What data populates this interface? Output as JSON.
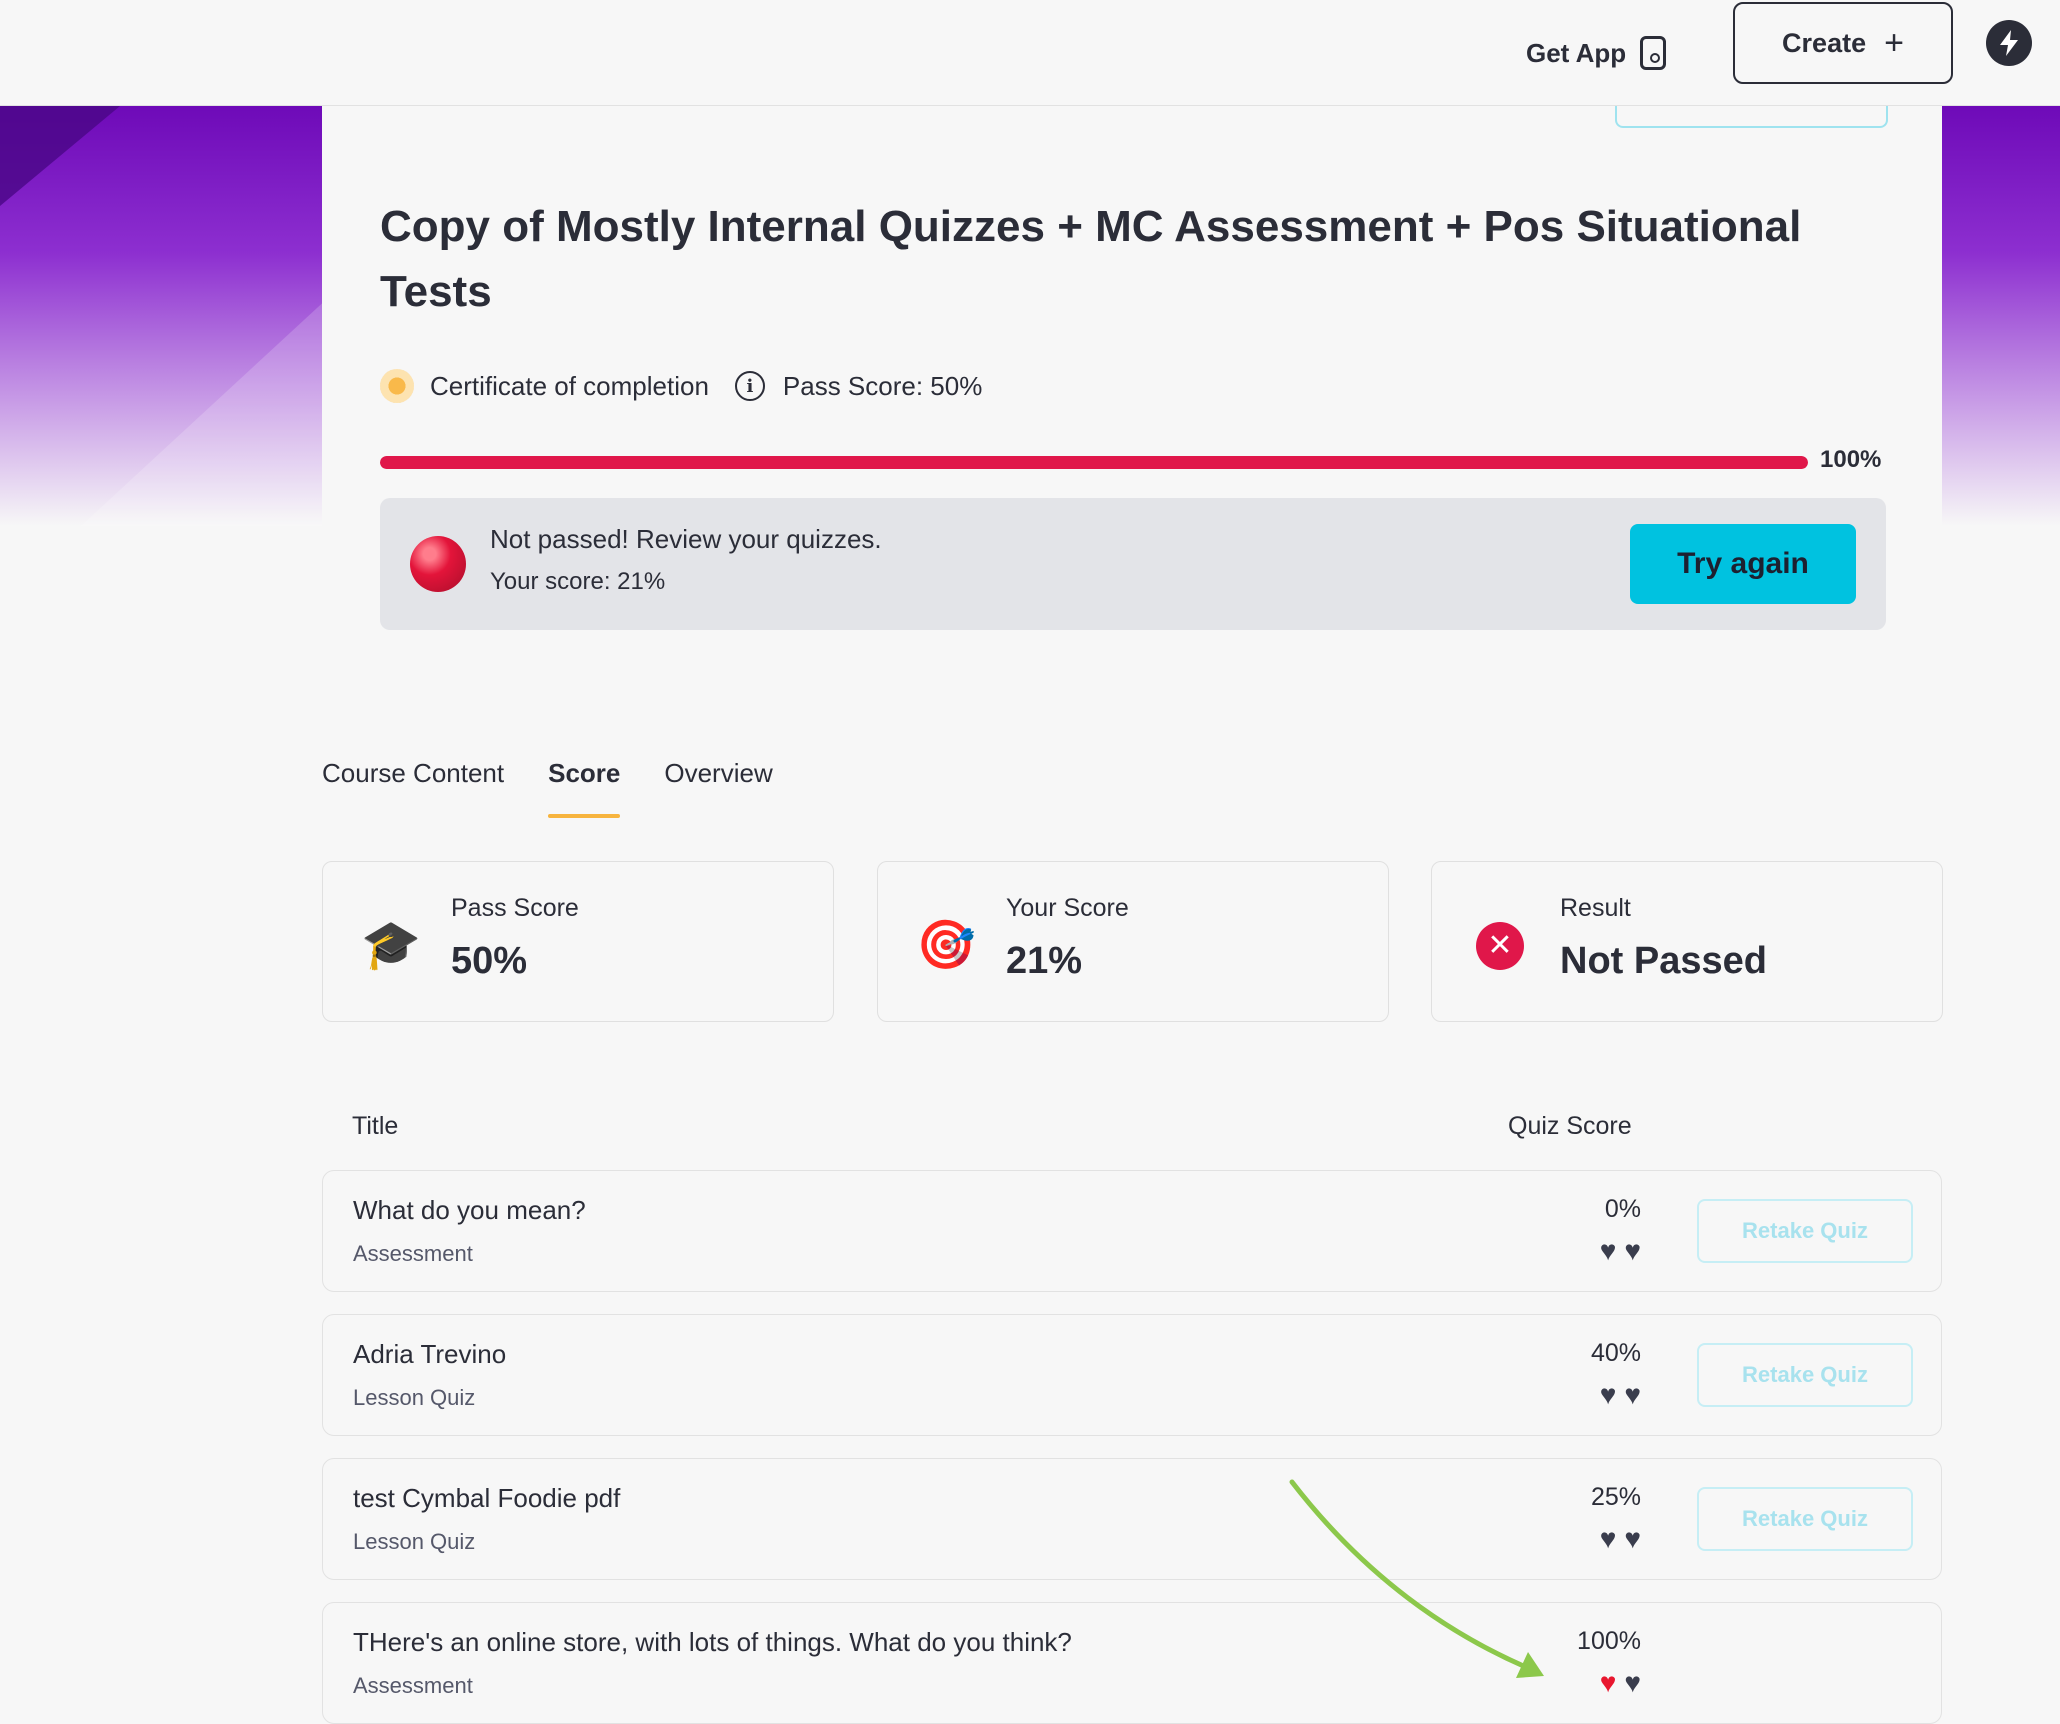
{
  "topbar": {
    "get_app_label": "Get App",
    "create_label": "Create",
    "plus_icon": "+",
    "bolt_icon": "lightning-bolt-icon"
  },
  "course": {
    "title": "Copy of Mostly Internal Quizzes + MC Assessment + Pos Situational Tests",
    "certificate_label": "Certificate of completion",
    "pass_score_label": "Pass Score: 50%",
    "progress_value": 100,
    "progress_label": "100%",
    "progress_color": "#e0174a"
  },
  "notice": {
    "message": "Not passed! Review your quizzes.",
    "score_text": "Your score: 21%",
    "try_again_label": "Try again",
    "button_color": "#00c2e0"
  },
  "tabs": [
    {
      "label": "Course Content",
      "active": false
    },
    {
      "label": "Score",
      "active": true
    },
    {
      "label": "Overview",
      "active": false
    }
  ],
  "score_cards": [
    {
      "label": "Pass Score",
      "value": "50%",
      "icon": "graduation-cap-icon",
      "glyph": "🎓"
    },
    {
      "label": "Your Score",
      "value": "21%",
      "icon": "target-dart-icon",
      "glyph": "🎯"
    },
    {
      "label": "Result",
      "value": "Not Passed",
      "icon": "result-x-icon",
      "glyph": "✕"
    }
  ],
  "table": {
    "title_header": "Title",
    "score_header": "Quiz Score",
    "retake_label": "Retake Quiz",
    "rows": [
      {
        "title": "What do you mean?",
        "type": "Assessment",
        "score": "0%",
        "hearts_filled": 0,
        "hearts_total": 2
      },
      {
        "title": "Adria Trevino",
        "type": "Lesson Quiz",
        "score": "40%",
        "hearts_filled": 0,
        "hearts_total": 2
      },
      {
        "title": "test Cymbal Foodie pdf",
        "type": "Lesson Quiz",
        "score": "25%",
        "hearts_filled": 0,
        "hearts_total": 2
      },
      {
        "title": "THere's an online store, with lots of things. What do you think?",
        "type": "Assessment",
        "score": "100%",
        "hearts_filled": 1,
        "hearts_total": 2
      }
    ]
  },
  "annotation": {
    "color": "#8cc84b"
  }
}
